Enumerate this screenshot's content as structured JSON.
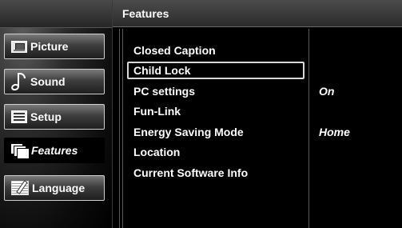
{
  "header": {
    "title": "Features"
  },
  "sidebar": {
    "items": [
      {
        "label": "Picture",
        "icon": "picture-icon",
        "active": false
      },
      {
        "label": "Sound",
        "icon": "sound-icon",
        "active": false
      },
      {
        "label": "Setup",
        "icon": "setup-icon",
        "active": false
      },
      {
        "label": "Features",
        "icon": "features-icon",
        "active": true
      },
      {
        "label": "Language",
        "icon": "language-icon",
        "active": false
      }
    ]
  },
  "main": {
    "items": [
      {
        "label": "Closed Caption",
        "value": ""
      },
      {
        "label": "Child Lock",
        "value": "",
        "selected": true
      },
      {
        "label": "PC settings",
        "value": "On"
      },
      {
        "label": "Fun-Link",
        "value": ""
      },
      {
        "label": "Energy Saving Mode",
        "value": "Home"
      },
      {
        "label": "Location",
        "value": ""
      },
      {
        "label": "Current Software Info",
        "value": ""
      }
    ]
  },
  "colors": {
    "background": "#000000",
    "text": "#ffffff",
    "highlight_border": "#d8d8d8"
  }
}
